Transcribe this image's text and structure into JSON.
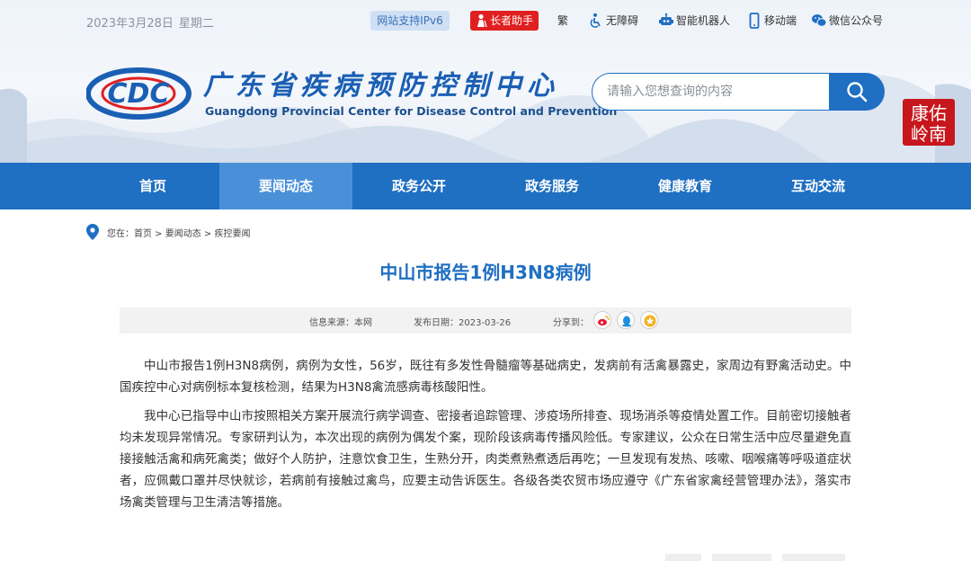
{
  "topbar": {
    "date": "2023年3月28日",
    "weekday": "星期二",
    "ipv6": "网站支持IPv6",
    "elder": "长者助手",
    "links": [
      {
        "label": "繁",
        "icon": "traditional-icon"
      },
      {
        "label": "无障碍",
        "icon": "accessibility-icon"
      },
      {
        "label": "智能机器人",
        "icon": "robot-icon"
      },
      {
        "label": "移动端",
        "icon": "mobile-icon"
      },
      {
        "label": "微信公众号",
        "icon": "wechat-icon"
      }
    ]
  },
  "logo": {
    "mark": "CDC",
    "name_cn": "广东省疾病预防控制中心",
    "name_en": "Guangdong Provincial Center for Disease Control and Prevention"
  },
  "search": {
    "placeholder": "请输入您想查询的内容"
  },
  "seal": {
    "text": "康佑岭南"
  },
  "nav": {
    "items": [
      "首页",
      "要闻动态",
      "政务公开",
      "政务服务",
      "健康教育",
      "互动交流"
    ],
    "active": "要闻动态"
  },
  "breadcrumb": {
    "text": "您在：首页 > 要闻动态 > 疾控要闻"
  },
  "article": {
    "title": "中山市报告1例H3N8病例",
    "source": "信息来源：本网",
    "date": "发布日期：2023-03-26",
    "share_label": "分享到：",
    "paragraphs": [
      "中山市报告1例H3N8病例，病例为女性，56岁，既往有多发性骨髓瘤等基础病史，发病前有活禽暴露史，家周边有野禽活动史。中国疾控中心对病例标本复核检测，结果为H3N8禽流感病毒核酸阳性。",
      "我中心已指导中山市按照相关方案开展流行病学调查、密接者追踪管理、涉疫场所排查、现场消杀等疫情处置工作。目前密切接触者均未发现异常情况。专家研判认为，本次出现的病例为偶发个案，现阶段该病毒传播风险低。专家建议，公众在日常生活中应尽量避免直接接触活禽和病死禽类；做好个人防护，注意饮食卫生，生熟分开，肉类煮熟煮透后再吃；一旦发现有发热、咳嗽、咽喉痛等呼吸道症状者，应佩戴口罩并尽快就诊，若病前有接触过禽鸟，应要主动告诉医生。各级各类农贸市场应遵守《广东省家禽经营管理办法》，落实市场禽类管理与卫生清洁等措施。"
    ]
  },
  "colors": {
    "primary": "#1f6fc2",
    "nav_active": "#4a90d9",
    "elder_red": "#e02020"
  }
}
